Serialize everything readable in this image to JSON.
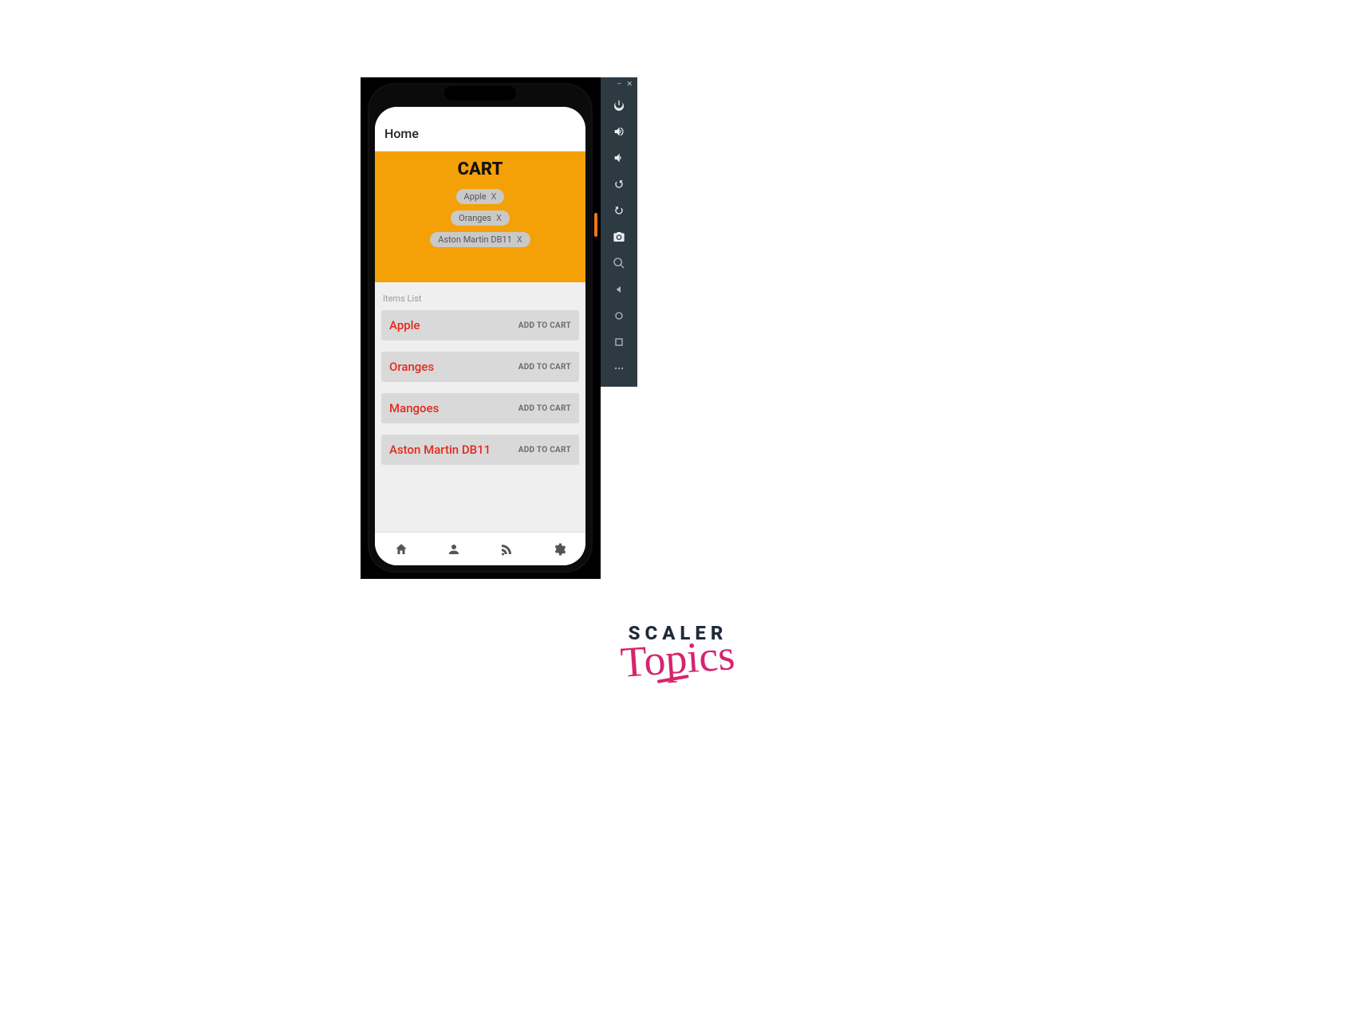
{
  "app": {
    "header_title": "Home",
    "cart_title": "CART",
    "items_heading": "Items List",
    "add_label": "ADD TO CART",
    "remove_label": "X"
  },
  "cart": {
    "items": [
      {
        "name": "Apple"
      },
      {
        "name": "Oranges"
      },
      {
        "name": "Aston Martin DB11"
      }
    ]
  },
  "items": [
    {
      "name": "Apple"
    },
    {
      "name": "Oranges"
    },
    {
      "name": "Mangoes"
    },
    {
      "name": "Aston Martin DB11"
    }
  ],
  "brand": {
    "top": "SCALER",
    "script": "Topics"
  }
}
